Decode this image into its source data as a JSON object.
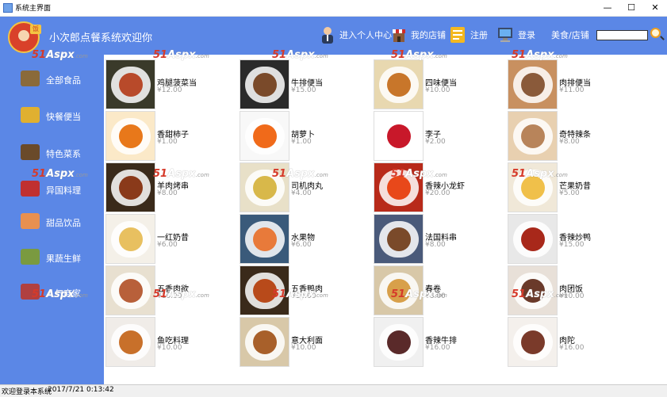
{
  "window": {
    "title": "系统主界面",
    "minimize_glyph": "—",
    "maximize_glyph": "☐",
    "close_glyph": "✕"
  },
  "header": {
    "welcome": "小次郎点餐系统欢迎你",
    "logo_badge": "饭",
    "nav": {
      "personal_center": "进入个人中心",
      "my_store": "我的店铺",
      "register": "注册",
      "login": "登录",
      "food_store": "美食/店铺"
    },
    "search_value": "",
    "icons": [
      "person-icon",
      "store-icon",
      "register-icon",
      "computer-login-icon",
      "search-icon"
    ]
  },
  "sidebar": {
    "items": [
      {
        "label": "全部食品",
        "icon": "food-crate-icon",
        "color": "#8a6a3a"
      },
      {
        "label": "快餐便当",
        "icon": "fast-food-icon",
        "color": "#e0b030"
      },
      {
        "label": "特色菜系",
        "icon": "specialty-dish-icon",
        "color": "#6a4a2a"
      },
      {
        "label": "异国料理",
        "icon": "foreign-cuisine-icon",
        "color": "#c03030"
      },
      {
        "label": "甜品饮品",
        "icon": "dessert-drink-icon",
        "color": "#e89050"
      },
      {
        "label": "果蔬生鲜",
        "icon": "fresh-produce-icon",
        "color": "#7a9a40"
      },
      {
        "label": "人气商家",
        "icon": "popular-merchant-icon",
        "color": "#b04040"
      }
    ]
  },
  "watermark": {
    "main": "51",
    "mid": "Aspx",
    "suffix": ".com"
  },
  "products": [
    {
      "name": "鸡腿菠菜当",
      "price": "¥12.00",
      "bg": "#3a3a2a",
      "food": "#b84a2a"
    },
    {
      "name": "牛排便当",
      "price": "¥15.00",
      "bg": "#2a2a2a",
      "food": "#7a4a2a"
    },
    {
      "name": "四味便当",
      "price": "¥10.00",
      "bg": "#e8d8b0",
      "food": "#c8762a"
    },
    {
      "name": "肉排便当",
      "price": "¥11.00",
      "bg": "#c89060",
      "food": "#8a5a3a"
    },
    {
      "name": "香甜柿子",
      "price": "¥1.00",
      "bg": "#fbe9c8",
      "food": "#e8781a"
    },
    {
      "name": "胡萝卜",
      "price": "¥1.00",
      "bg": "#f8f8f8",
      "food": "#f06a1a"
    },
    {
      "name": "李子",
      "price": "¥2.00",
      "bg": "#ffffff",
      "food": "#c8182a"
    },
    {
      "name": "奇特辣条",
      "price": "¥8.00",
      "bg": "#e8d0b0",
      "food": "#b8845a"
    },
    {
      "name": "羊肉烤串",
      "price": "¥8.00",
      "bg": "#3a2a1a",
      "food": "#8a3a1a"
    },
    {
      "name": "司机肉丸",
      "price": "¥4.00",
      "bg": "#e8e0c8",
      "food": "#d8b84a"
    },
    {
      "name": "香辣小龙虾",
      "price": "¥20.00",
      "bg": "#b82a1a",
      "food": "#e8481a"
    },
    {
      "name": "芒果奶昔",
      "price": "¥5.00",
      "bg": "#f0e8d8",
      "food": "#f0c04a"
    },
    {
      "name": "一红奶昔",
      "price": "¥6.00",
      "bg": "#f4f0e8",
      "food": "#e8c060"
    },
    {
      "name": "水果物",
      "price": "¥6.00",
      "bg": "#3a5a7a",
      "food": "#e87a3a"
    },
    {
      "name": "法国料串",
      "price": "¥8.00",
      "bg": "#4a5a7a",
      "food": "#7a4a2a"
    },
    {
      "name": "香辣炒鸭",
      "price": "¥15.00",
      "bg": "#e8e8e8",
      "food": "#a8281a"
    },
    {
      "name": "五香肉欲",
      "price": "¥10.00",
      "bg": "#e8e0d0",
      "food": "#b8603a"
    },
    {
      "name": "五香鸭肉",
      "price": "¥10.00",
      "bg": "#3a2a1a",
      "food": "#b84a1a"
    },
    {
      "name": "春卷",
      "price": "¥8.00",
      "bg": "#d8c8a8",
      "food": "#d8a04a"
    },
    {
      "name": "肉团饭",
      "price": "¥10.00",
      "bg": "#e8e0d8",
      "food": "#6a3a2a"
    },
    {
      "name": "鱼吃料理",
      "price": "¥10.00",
      "bg": "#f0ece8",
      "food": "#c8702a"
    },
    {
      "name": "意大利面",
      "price": "¥10.00",
      "bg": "#d8c8a8",
      "food": "#a8602a"
    },
    {
      "name": "香辣牛排",
      "price": "¥16.00",
      "bg": "#f0f0f0",
      "food": "#5a2a2a"
    },
    {
      "name": "肉陀",
      "price": "¥16.00",
      "bg": "#f4f0ec",
      "food": "#7a3a2a"
    }
  ],
  "status": {
    "message": "欢迎登录本系统",
    "datetime": "2017/7/21 0:13:42"
  }
}
